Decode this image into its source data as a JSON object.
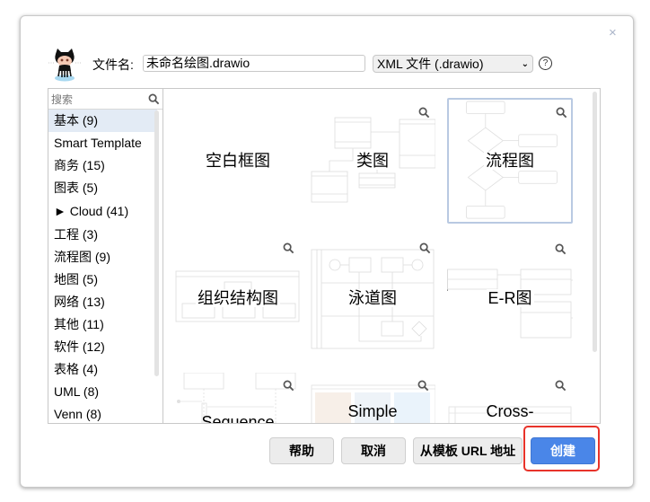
{
  "dialog": {
    "close_icon": "×",
    "filename_label": "文件名:",
    "filename_value": "未命名绘图.drawio",
    "format_selected": "XML 文件 (.drawio)",
    "help_icon": "?"
  },
  "sidebar": {
    "search_placeholder": "搜索",
    "categories": [
      {
        "label": "基本 (9)",
        "selected": true
      },
      {
        "label": "Smart Template"
      },
      {
        "label": "商务 (15)"
      },
      {
        "label": "图表 (5)"
      },
      {
        "label": "► Cloud (41)"
      },
      {
        "label": "工程 (3)"
      },
      {
        "label": "流程图 (9)"
      },
      {
        "label": "地图 (5)"
      },
      {
        "label": "网络 (13)"
      },
      {
        "label": "其他 (11)"
      },
      {
        "label": "软件 (12)"
      },
      {
        "label": "表格 (4)"
      },
      {
        "label": "UML (8)"
      },
      {
        "label": "Venn (8)"
      }
    ]
  },
  "templates": [
    {
      "label": "空白框图",
      "selected": false
    },
    {
      "label": "类图"
    },
    {
      "label": "流程图",
      "selected": true
    },
    {
      "label": "组织结构图"
    },
    {
      "label": "泳道图"
    },
    {
      "label": "E-R图"
    },
    {
      "label": "Sequence"
    },
    {
      "label": "Simple"
    },
    {
      "label": "Cross-"
    }
  ],
  "buttons": {
    "help": "帮助",
    "cancel": "取消",
    "from_url": "从模板 URL 地址",
    "create": "创建"
  },
  "colors": {
    "primary": "#4a86e8",
    "highlight": "#e8332a",
    "selected_bg": "#e3ebf5"
  }
}
